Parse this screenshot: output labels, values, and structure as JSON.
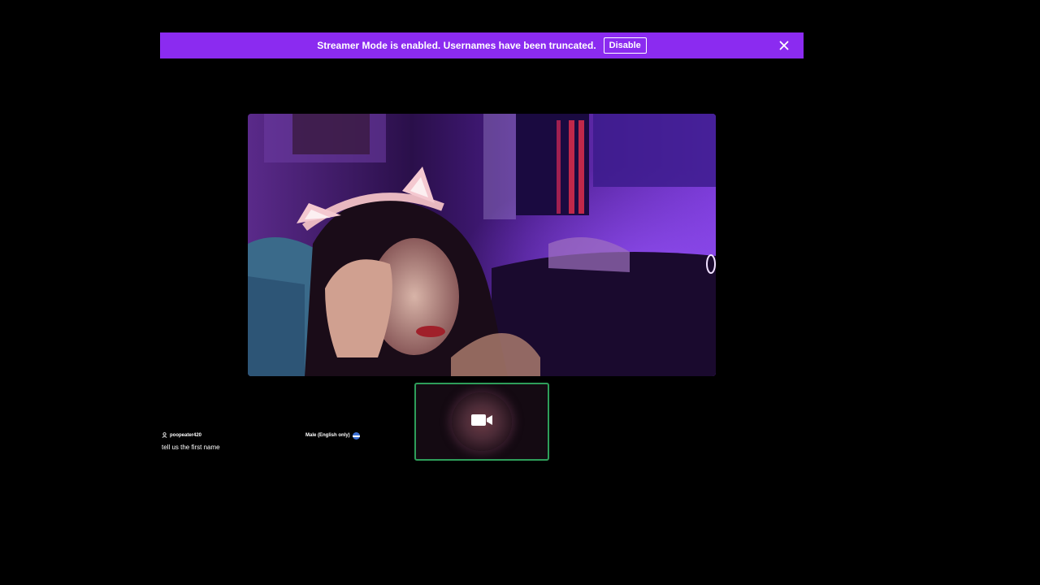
{
  "banner": {
    "message": "Streamer Mode is enabled. Usernames have been truncated.",
    "disable_label": "Disable",
    "close_icon": "close-icon",
    "color": "#8b2bf0"
  },
  "partner_video": {
    "description_icon": "partner-video-feed"
  },
  "self_view": {
    "icon": "video-camera-icon",
    "border_color": "#2e9e5a"
  },
  "chat": {
    "username": "poopeater420",
    "user_icon": "user-icon",
    "message": "tell us the first name"
  },
  "partner": {
    "info": "Male (English only)",
    "flag_icon": "flag-icon"
  }
}
